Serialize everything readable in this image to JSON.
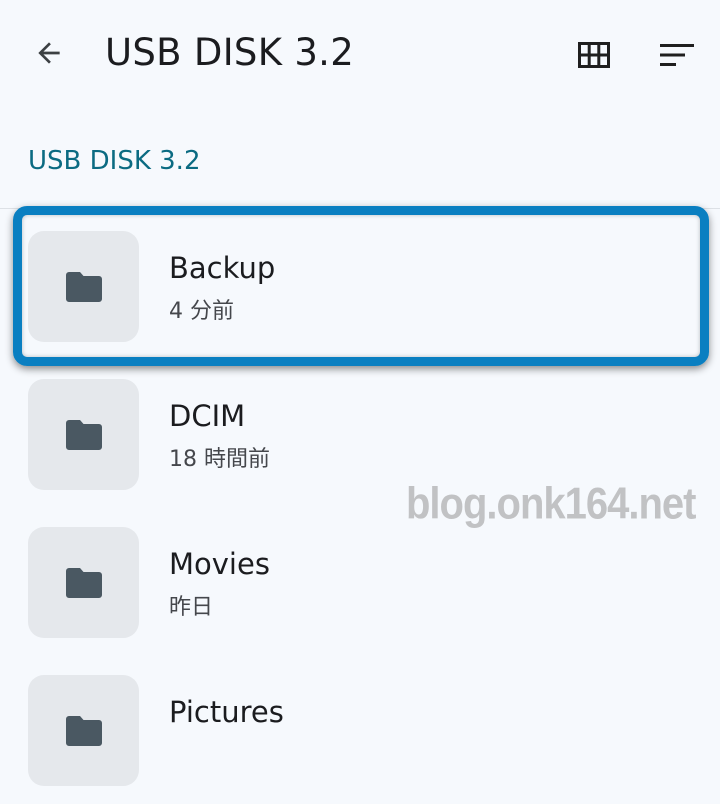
{
  "app_bar": {
    "title": "USB DISK 3.2",
    "back_icon": "arrow-back-icon",
    "grid_icon": "grid-view-icon",
    "sort_icon": "sort-icon"
  },
  "breadcrumb": {
    "label": "USB DISK 3.2"
  },
  "files": [
    {
      "name": "Backup",
      "meta": "4 分前",
      "icon": "folder-icon",
      "highlighted": true
    },
    {
      "name": "DCIM",
      "meta": "18 時間前",
      "icon": "folder-icon",
      "highlighted": false
    },
    {
      "name": "Movies",
      "meta": "昨日",
      "icon": "folder-icon",
      "highlighted": false
    },
    {
      "name": "Pictures",
      "meta": "",
      "icon": "folder-icon",
      "highlighted": false
    }
  ],
  "watermark": {
    "text": "blog.onk164.net"
  },
  "colors": {
    "background": "#f6f9fd",
    "accent": "#0b6b82",
    "highlight_border": "#0a7fc1",
    "thumb_bg": "#e5e8ec",
    "folder_icon": "#4a5862"
  }
}
